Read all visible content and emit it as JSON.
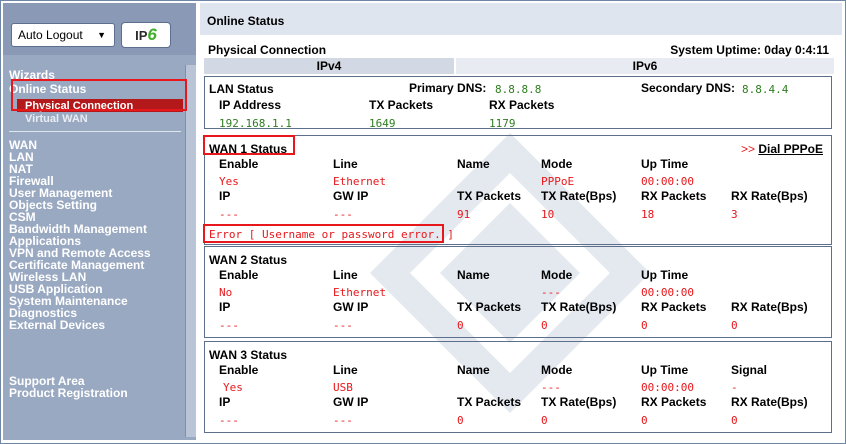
{
  "sidebar": {
    "auto_logout": "Auto Logout",
    "ipv6_logo_text": "IP",
    "ipv6_logo_six": "6",
    "menu": {
      "wizards": "Wizards",
      "online_status": "Online Status",
      "physical_connection": "Physical Connection",
      "virtual_wan": "Virtual WAN",
      "items": [
        "WAN",
        "LAN",
        "NAT",
        "Firewall",
        "User Management",
        "Objects Setting",
        "CSM",
        "Bandwidth Management",
        "Applications",
        "VPN and Remote Access",
        "Certificate Management",
        "Wireless LAN",
        "USB Application",
        "System Maintenance",
        "Diagnostics",
        "External Devices"
      ],
      "support_area": "Support Area",
      "product_registration": "Product Registration"
    }
  },
  "main": {
    "title": "Online Status",
    "physical_connection": "Physical Connection",
    "system_uptime": "System Uptime: 0day 0:4:11",
    "tabs": {
      "ipv4": "IPv4",
      "ipv6": "IPv6"
    },
    "lan": {
      "title": "LAN Status",
      "primary_dns_label": "Primary DNS:",
      "primary_dns": "8.8.8.8",
      "secondary_dns_label": "Secondary DNS:",
      "secondary_dns": "8.8.4.4",
      "headers": {
        "ip": "IP Address",
        "tx": "TX Packets",
        "rx": "RX Packets"
      },
      "values": {
        "ip": "192.168.1.1",
        "tx": "1649",
        "rx": "1179"
      }
    },
    "headers": {
      "enable": "Enable",
      "line": "Line",
      "name": "Name",
      "mode": "Mode",
      "uptime": "Up Time",
      "signal": "Signal",
      "ip": "IP",
      "gwip": "GW IP",
      "tx_packets": "TX Packets",
      "tx_rate": "TX Rate(Bps)",
      "rx_packets": "RX Packets",
      "rx_rate": "RX Rate(Bps)"
    },
    "wan1": {
      "title": "WAN 1 Status",
      "dial_prefix": ">>",
      "dial_link": "Dial PPPoE",
      "enable": "Yes",
      "line": "Ethernet",
      "name": "",
      "mode": "PPPoE",
      "uptime": "00:00:00",
      "ip": "---",
      "gwip": "---",
      "tx_packets": "91",
      "tx_rate": "10",
      "rx_packets": "18",
      "rx_rate": "3",
      "error": "Error [ Username or password error. ]"
    },
    "wan2": {
      "title": "WAN 2 Status",
      "enable": "No",
      "line": "Ethernet",
      "name": "",
      "mode": "---",
      "uptime": "00:00:00",
      "ip": "---",
      "gwip": "---",
      "tx_packets": "0",
      "tx_rate": "0",
      "rx_packets": "0",
      "rx_rate": "0"
    },
    "wan3": {
      "title": "WAN 3 Status",
      "enable": "Yes",
      "line": "USB",
      "name": "",
      "mode": "---",
      "uptime": "00:00:00",
      "signal": "-",
      "ip": "---",
      "gwip": "---",
      "tx_packets": "0",
      "tx_rate": "0",
      "rx_packets": "0",
      "rx_rate": "0"
    }
  },
  "colors": {
    "accent_red": "#e8171b",
    "value_green": "#2e7d1f",
    "sidebar_bg": "#9aa9c2",
    "active_item": "#b3191a"
  }
}
